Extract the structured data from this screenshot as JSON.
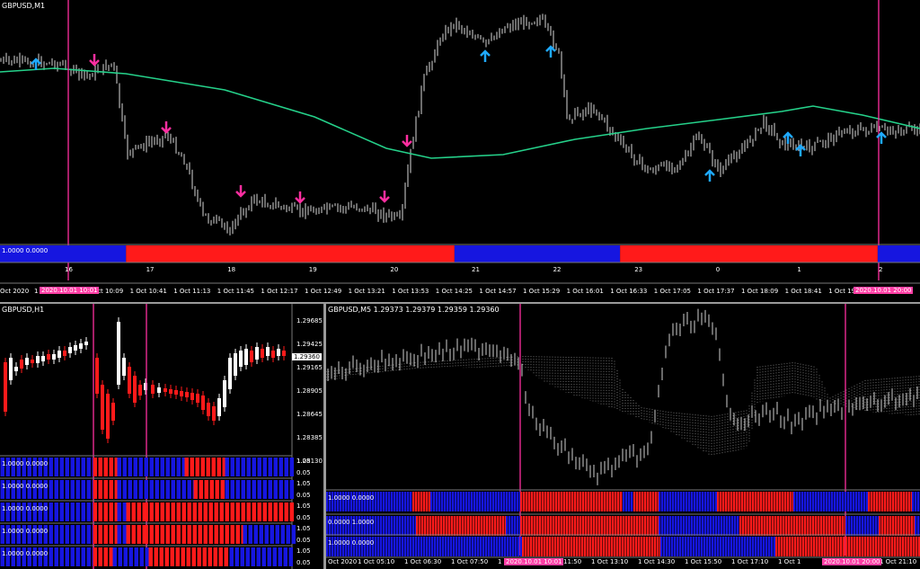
{
  "colors": {
    "bg": "#000000",
    "red": "#ff1a1a",
    "blue": "#1616e0",
    "magenta": "#ff2ea0",
    "ma": "#25d18a",
    "up_arrow": "#1fa9ff",
    "down_arrow": "#ff2ea0"
  },
  "icons": {
    "up": "up-arrow-icon",
    "down": "down-arrow-icon"
  },
  "main": {
    "title": "GBPUSD,M1",
    "indicator_label": "1.0000 0.0000",
    "day_labels": [
      "16",
      "17",
      "18",
      "19",
      "20",
      "21",
      "22",
      "23",
      "0",
      "1",
      "2"
    ],
    "time_labels": [
      "Oct 2020",
      "1",
      "1 Oct 10:09",
      "1 Oct 10:41",
      "1 Oct 11:13",
      "1 Oct 11:45",
      "1 Oct 12:17",
      "1 Oct 12:49",
      "1 Oct 13:21",
      "1 Oct 13:53",
      "1 Oct 14:25",
      "1 Oct 14:57",
      "1 Oct 15:29",
      "1 Oct 16:01",
      "1 Oct 16:33",
      "1 Oct 17:05",
      "1 Oct 17:37",
      "1 Oct 18:09",
      "1 Oct 18:41",
      "1 Oct 19:13",
      "1 Oct 2"
    ],
    "highlight1": "2020.10.01 10:01",
    "highlight2": "2020.10.01 20:00",
    "band": [
      "blue",
      "red",
      "blue",
      "red",
      "blue"
    ],
    "band_share": [
      0.137,
      0.357,
      0.18,
      0.28,
      0.046
    ]
  },
  "h1": {
    "title": "GBPUSD,H1",
    "prices": [
      "1.29685",
      "1.29425",
      "1.29165",
      "1.28905",
      "1.28645",
      "1.28385",
      "1.28130"
    ],
    "current_price": "1.29360",
    "indicator_labels": [
      "1.0000 0.0000",
      "1.0000 0.0000",
      "1.0000 0.0000",
      "1.0000 0.0000",
      "1.0000 0.0000"
    ],
    "scale_labels": [
      "1.05",
      "0.05",
      "1.05",
      "0.05",
      "1.05",
      "0.05",
      "1.05",
      "0.05",
      "1.05",
      "0.05"
    ]
  },
  "m5": {
    "title": "GBPUSD,M5  1.29373 1.29379 1.29359 1.29360",
    "indicator_labels": [
      "1.0000 0.0000",
      "0.0000 1.0000",
      "1.0000 0.0000"
    ],
    "time_labels": [
      "Oct 2020",
      "1 Oct 05:10",
      "1 Oct 06:30",
      "1 Oct 07:50",
      "1 Oct 10:30",
      "1 Oct 11:50",
      "1 Oct 13:10",
      "1 Oct 14:30",
      "1 Oct 15:50",
      "1 Oct 17:10",
      "1 Oct 1",
      "1 Oct 21:10"
    ],
    "highlight1": "2020.10.01 10:01",
    "highlight2": "2020.10.01 20:00"
  }
}
